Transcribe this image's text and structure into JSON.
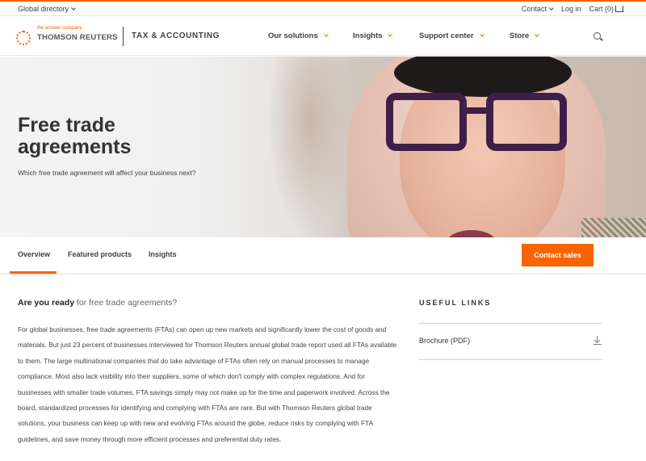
{
  "topbar": {
    "global_directory": "Global directory",
    "contact": "Contact",
    "login": "Log in",
    "cart": "Cart (0)"
  },
  "header": {
    "logo_tagline": "the answer company",
    "logo_name": "THOMSON REUTERS",
    "division": "TAX & ACCOUNTING",
    "nav": [
      "Our solutions",
      "Insights",
      "Support center",
      "Store"
    ],
    "search_icon": "search-icon"
  },
  "hero": {
    "title": "Free trade agreements",
    "subtitle": "Which free trade agreement will affect your business next?"
  },
  "tabs": {
    "items": [
      "Overview",
      "Featured products",
      "Insights"
    ],
    "active": "Overview",
    "cta": "Contact sales"
  },
  "content": {
    "lead_strong": "Are you ready",
    "lead_rest": " for free trade agreements?",
    "body": "For global businesses, free trade agreements (FTAs) can open up new markets and significantly lower the cost of goods and materials. But just 23 percent of businesses interviewed for Thomson Reuters annual global trade report used all FTAs available to them. The large multinational companies that do take advantage of FTAs often rely on manual processes to manage compliance. Most also lack visibility into their suppliers, some of which don't comply with complex regulations. And for businesses with smaller trade volumes, FTA savings simply may not make up for the time and paperwork involved. Across the board, standardized processes for identifying and complying with FTAs are rare. But with Thomson Reuters global trade solutions, your business can keep up with new and evolving FTAs around the globe, reduce risks by complying with FTA guidelines, and save money through more efficient processes and preferential duty rates."
  },
  "sidebar": {
    "title": "USEFUL LINKS",
    "links": [
      "Brochure (PDF)"
    ],
    "link_icon": "download-icon"
  },
  "colors": {
    "accent": "#fa6400",
    "text": "#404040"
  }
}
